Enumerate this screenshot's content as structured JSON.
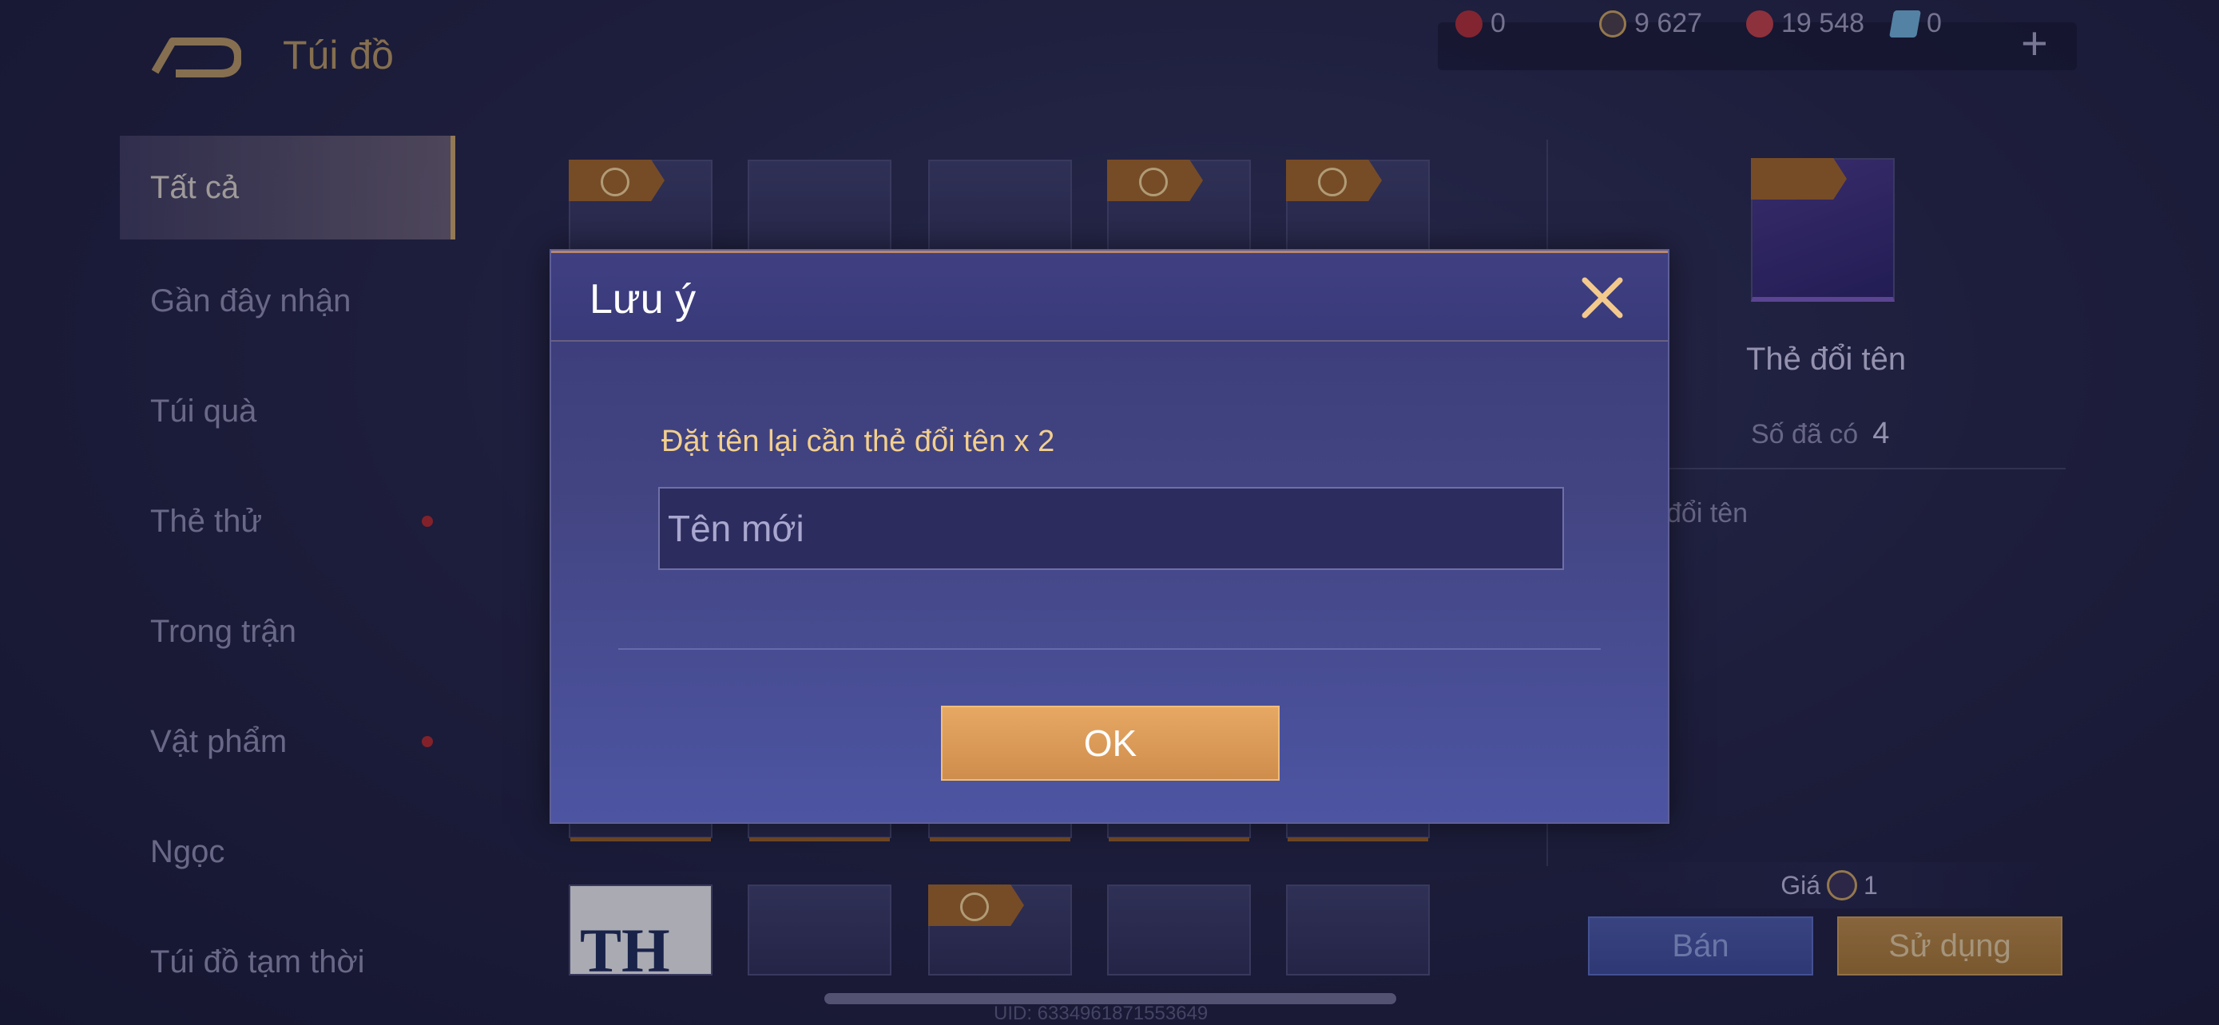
{
  "header": {
    "title": "Túi đồ"
  },
  "currencies": [
    {
      "value": "0",
      "icon": "red-gem-icon",
      "color": "#b0303a"
    },
    {
      "value": "9 627",
      "icon": "gold-coin-icon",
      "color": "#c9a260"
    },
    {
      "value": "19 548",
      "icon": "ruby-icon",
      "color": "#c0404a"
    },
    {
      "value": "0",
      "icon": "blue-card-icon",
      "color": "#6fb0d8"
    }
  ],
  "sidebar": {
    "items": [
      {
        "label": "Tất cả"
      },
      {
        "label": "Gần đây nhận"
      },
      {
        "label": "Túi quà"
      },
      {
        "label": "Thẻ thử"
      },
      {
        "label": "Trong trận"
      },
      {
        "label": "Vật phẩm"
      },
      {
        "label": "Ngọc"
      },
      {
        "label": "Túi đồ tạm thời"
      }
    ]
  },
  "grid": {
    "bottom_card_label": "TH"
  },
  "detail": {
    "name": "Thẻ đổi tên",
    "owned_label": "Số đã có",
    "owned_value": "4",
    "description": "đổi tên",
    "price_label": "Giá",
    "price_value": "1",
    "sell_label": "Bán",
    "use_label": "Sử dụng"
  },
  "footer": {
    "uid": "UID: 6334961871553649"
  },
  "modal": {
    "title": "Lưu ý",
    "hint": "Đặt tên lại cần thẻ đổi tên x 2",
    "input_placeholder": "Tên mới",
    "ok_label": "OK"
  },
  "colors": {
    "accent_gold": "#c8a46a",
    "ok_button": "#e7a864",
    "modal_bg": "#434583",
    "hint_text": "#f2cf8d"
  }
}
